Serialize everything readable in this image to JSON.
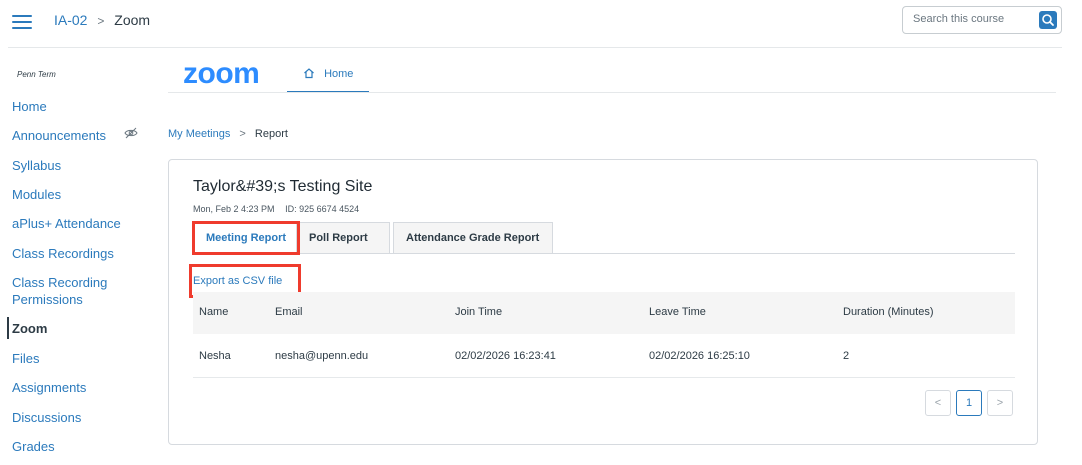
{
  "header": {
    "menu_icon": "hamburger-icon",
    "breadcrumb": {
      "course": "IA-02",
      "separator": ">",
      "current": "Zoom"
    },
    "search_placeholder": "Search this course",
    "search_icon": "search-icon"
  },
  "sidebar": {
    "term": "Penn Term",
    "items": [
      {
        "label": "Home"
      },
      {
        "label": "Announcements",
        "icon": "eye-slash-icon"
      },
      {
        "label": "Syllabus"
      },
      {
        "label": "Modules"
      },
      {
        "label": "aPlus+ Attendance"
      },
      {
        "label": "Class Recordings"
      },
      {
        "label": "Class Recording Permissions"
      },
      {
        "label": "Zoom",
        "active": true
      },
      {
        "label": "Files"
      },
      {
        "label": "Assignments"
      },
      {
        "label": "Discussions"
      },
      {
        "label": "Grades"
      }
    ]
  },
  "zoom": {
    "logo": "zoom",
    "tab_home": "Home",
    "breadcrumb": {
      "parent": "My Meetings",
      "separator": ">",
      "current": "Report"
    }
  },
  "meeting": {
    "title": "Taylor&#39;s Testing Site",
    "date": "Mon, Feb 2 4:23 PM",
    "id_label": "ID: 925 6674 4524"
  },
  "tabs": [
    {
      "label": "Meeting Report",
      "active": true
    },
    {
      "label": "Poll Report"
    },
    {
      "label": "Attendance Grade Report"
    }
  ],
  "export_label": "Export as CSV file",
  "table": {
    "headers": [
      "Name",
      "Email",
      "Join Time",
      "Leave Time",
      "Duration (Minutes)"
    ],
    "rows": [
      [
        "Nesha",
        "nesha@upenn.edu",
        "02/02/2026 16:23:41",
        "02/02/2026 16:25:10",
        "2"
      ]
    ]
  },
  "pagination": {
    "prev": "<",
    "current": "1",
    "next": ">"
  },
  "colors": {
    "accent": "#2b7abc",
    "zoom_brand": "#2d8cff",
    "highlight": "#ef3b2d"
  }
}
